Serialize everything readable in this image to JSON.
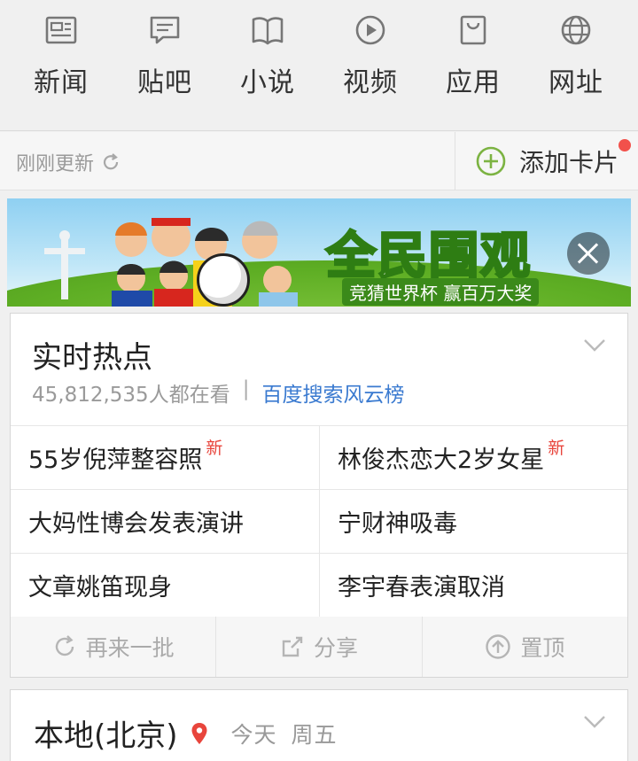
{
  "topnav": {
    "items": [
      {
        "label": "新闻",
        "icon": "news-icon"
      },
      {
        "label": "贴吧",
        "icon": "chat-bubble-icon"
      },
      {
        "label": "小说",
        "icon": "book-icon"
      },
      {
        "label": "视频",
        "icon": "play-circle-icon"
      },
      {
        "label": "应用",
        "icon": "bag-icon"
      },
      {
        "label": "网址",
        "icon": "globe-icon"
      }
    ]
  },
  "statusbar": {
    "updated": "刚刚更新",
    "add_card": "添加卡片"
  },
  "banner": {
    "title": "全民围观",
    "subtitle": "竞猜世界杯 赢百万大奖"
  },
  "hot_card": {
    "title": "实时热点",
    "viewers": "45,812,535人都在看",
    "separator": "|",
    "link": "百度搜索风云榜",
    "new_badge": "新",
    "items": [
      {
        "text": "55岁倪萍整容照",
        "is_new": true
      },
      {
        "text": "林俊杰恋大2岁女星",
        "is_new": true
      },
      {
        "text": "大妈性博会发表演讲",
        "is_new": false
      },
      {
        "text": "宁财神吸毒",
        "is_new": false
      },
      {
        "text": "文章姚笛现身",
        "is_new": false
      },
      {
        "text": "李宇春表演取消",
        "is_new": false
      }
    ],
    "actions": {
      "refresh": "再来一批",
      "share": "分享",
      "pin": "置顶"
    }
  },
  "local_card": {
    "city": "本地(北京)",
    "day": "今天",
    "weekday": "周五"
  },
  "colors": {
    "accent_green": "#7cb342",
    "link_blue": "#3a7ad0",
    "new_red": "#e8453c"
  }
}
